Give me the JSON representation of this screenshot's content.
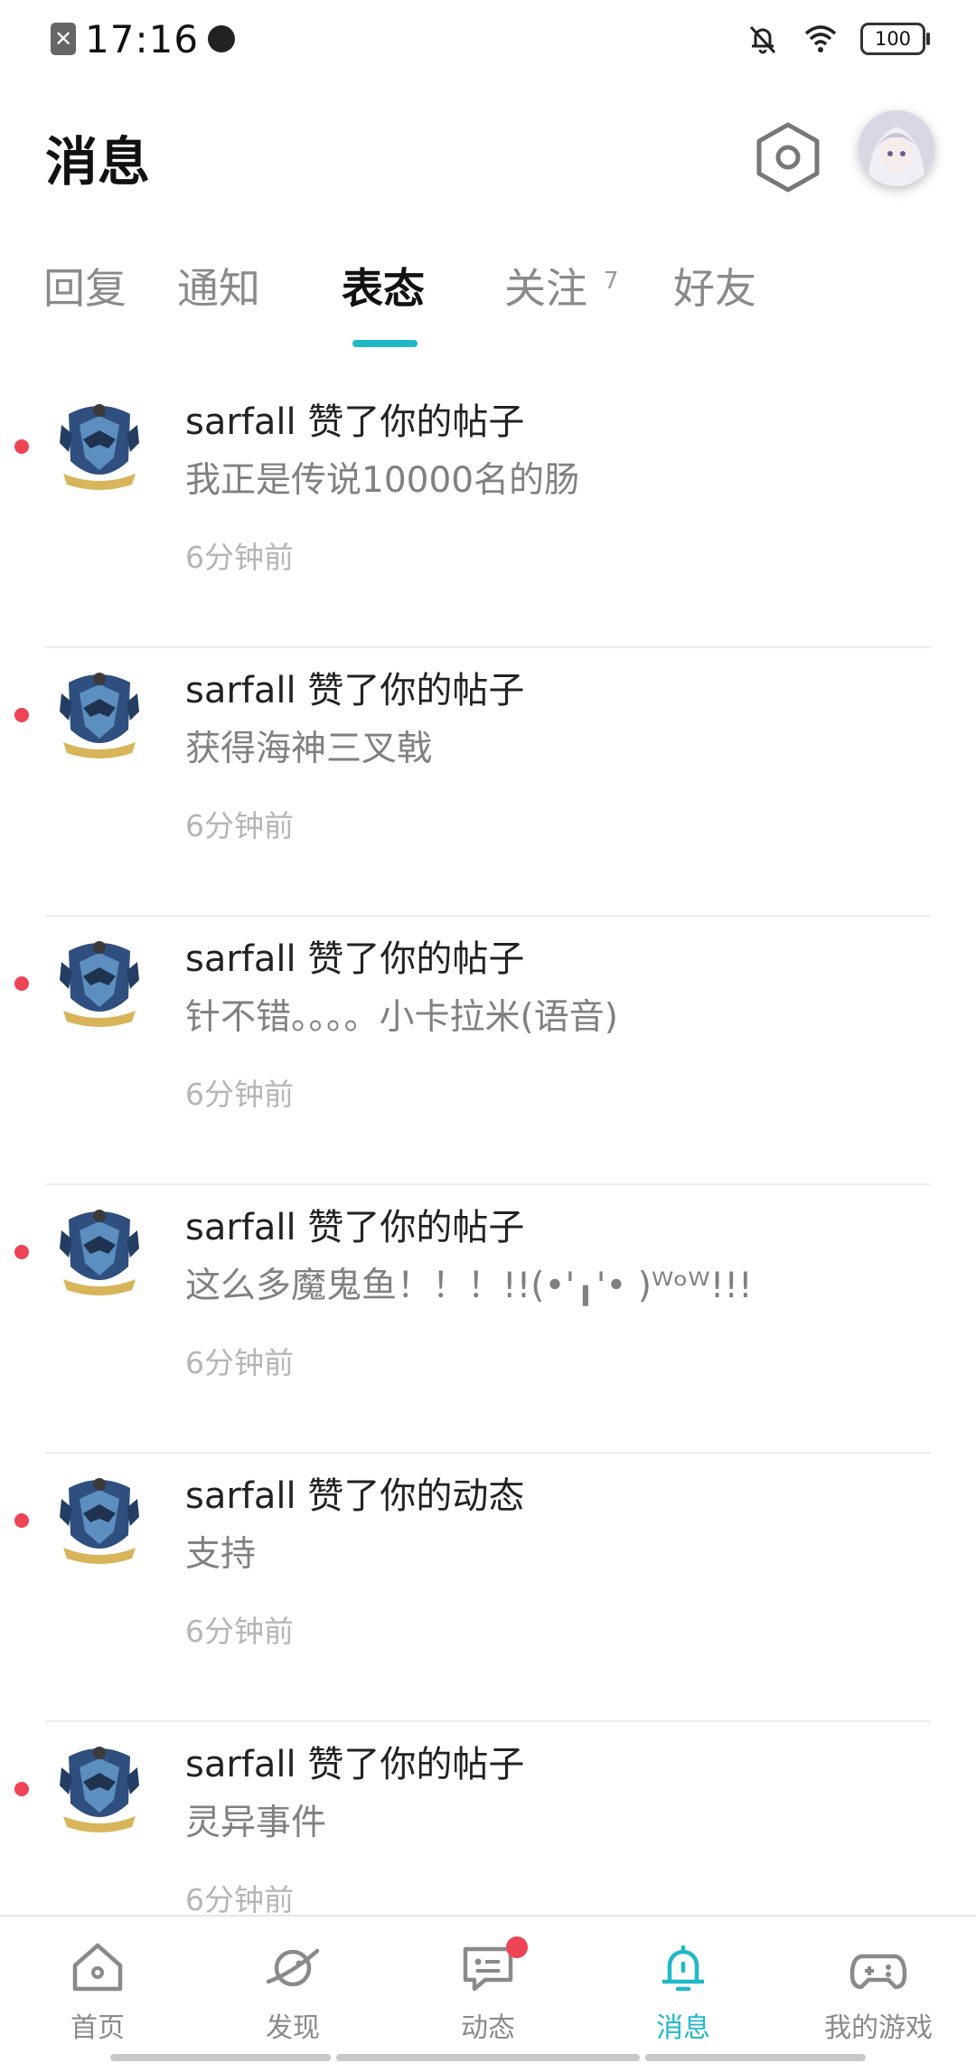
{
  "status_bar": {
    "time": "17:16",
    "battery": "100"
  },
  "header": {
    "title": "消息"
  },
  "tabs": [
    {
      "label": "回复",
      "active": false
    },
    {
      "label": "通知",
      "active": false
    },
    {
      "label": "表态",
      "active": true
    },
    {
      "label": "关注",
      "badge": "7",
      "active": false
    },
    {
      "label": "好友",
      "active": false
    }
  ],
  "colors": {
    "accent": "#20b8c6",
    "unread": "#ee4455"
  },
  "messages": [
    {
      "title": "sarfall 赞了你的帖子",
      "content": "我正是传说10000名的肠",
      "time": "6分钟前"
    },
    {
      "title": "sarfall 赞了你的帖子",
      "content": "获得海神三叉戟",
      "time": "6分钟前"
    },
    {
      "title": "sarfall 赞了你的帖子",
      "content": "针不错。。。。小卡拉米(语音)",
      "time": "6分钟前"
    },
    {
      "title": "sarfall 赞了你的帖子",
      "content": "这么多魔鬼鱼！！！!!(•'╻'• )ᵂᵒᵂ!!!",
      "time": "6分钟前"
    },
    {
      "title": "sarfall 赞了你的动态",
      "content": "支持",
      "time": "6分钟前"
    },
    {
      "title": "sarfall 赞了你的帖子",
      "content": "灵异事件",
      "time": "6分钟前"
    }
  ],
  "bottom_nav": [
    {
      "label": "首页",
      "icon": "home-icon"
    },
    {
      "label": "发现",
      "icon": "planet-icon"
    },
    {
      "label": "动态",
      "icon": "chat-icon"
    },
    {
      "label": "消息",
      "icon": "bell-icon",
      "active": true
    },
    {
      "label": "我的游戏",
      "icon": "gamepad-icon"
    }
  ]
}
